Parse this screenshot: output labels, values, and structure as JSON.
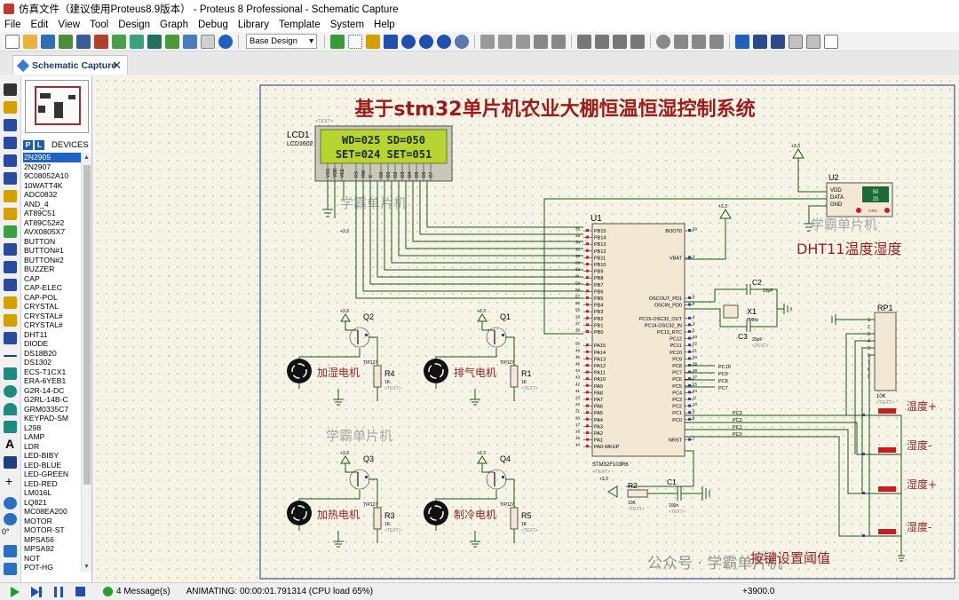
{
  "window": {
    "title": "仿真文件（建议使用Proteus8.9版本） - Proteus 8 Professional - Schematic Capture"
  },
  "menu": [
    "File",
    "Edit",
    "View",
    "Tool",
    "Design",
    "Graph",
    "Debug",
    "Library",
    "Template",
    "System",
    "Help"
  ],
  "toolbar": {
    "design_select": "Base Design"
  },
  "tab": {
    "label": "Schematic Capture"
  },
  "device_panel": {
    "header": "DEVICES",
    "items": [
      "2N2905",
      "2N2907",
      "9C08052A10",
      "10WATT4K",
      "ADC0832",
      "AND_4",
      "AT89C51",
      "AT89C52#2",
      "AVX0805X7",
      "BUTTON",
      "BUTTON#1",
      "BUTTON#2",
      "BUZZER",
      "CAP",
      "CAP-ELEC",
      "CAP-POL",
      "CRYSTAL",
      "CRYSTAL#",
      "CRYSTAL#",
      "DHT11",
      "DIODE",
      "DS18B20",
      "DS1302",
      "ECS-T1CX1",
      "ERA-6YEB1",
      "G2R-14-DC",
      "G2RL-14B-C",
      "GRM0335C7",
      "KEYPAD-SM",
      "L298",
      "LAMP",
      "LDR",
      "LED-BIBY",
      "LED-BLUE",
      "LED-GREEN",
      "LED-RED",
      "LM016L",
      "LQ821",
      "MC08EA200",
      "MOTOR",
      "MOTOR-ST",
      "MPSA56",
      "MPSA92",
      "NOT",
      "POT-HG"
    ],
    "selected_index": 0,
    "rotation_label": "0°"
  },
  "schematic": {
    "title": "基于stm32单片机农业大棚恒温恒湿控制系统",
    "lcd": {
      "ref": "LCD1",
      "part": "LCD1602",
      "line1": "WD=025  SD=050",
      "line2": "SET=024 SET=051",
      "text_tag": "<TEXT>",
      "pins": [
        "VSS",
        "VDD",
        "VEE",
        "RS",
        "RW",
        "E",
        "D0",
        "D1",
        "D2",
        "D3",
        "D4",
        "D5",
        "D6",
        "D7"
      ]
    },
    "watermark": "学霸单片机",
    "dht": {
      "ref": "U2",
      "label": "DHT11温度湿度",
      "pins": [
        "VDD",
        "DATA",
        "GND"
      ],
      "temp": "50",
      "hum": "25",
      "unit": "%RH",
      "power": "+3.3"
    },
    "mcu": {
      "ref": "U1",
      "part": "STM32F103R6",
      "text_tag": "<TEXT>",
      "left_pins": [
        "PB15",
        "PB14",
        "PB13",
        "PB12",
        "PB11",
        "PB10",
        "PB9",
        "PB8",
        "PB7",
        "PB6",
        "PB5",
        "PB4",
        "PB3",
        "PB2",
        "PB1",
        "PB0",
        "",
        "PA15",
        "PA14",
        "PA13",
        "PA12",
        "PA11",
        "PA10",
        "PA9",
        "PA8",
        "PA7",
        "PA6",
        "PA5",
        "PA4",
        "PA3",
        "PA2",
        "PA1",
        "PA0-WKUP"
      ],
      "left_nums": [
        "36",
        "35",
        "34",
        "33",
        "30",
        "29",
        "62",
        "61",
        "59",
        "58",
        "57",
        "56",
        "55",
        "28",
        "27",
        "26",
        "",
        "50",
        "49",
        "46",
        "45",
        "44",
        "43",
        "42",
        "41",
        "23",
        "22",
        "21",
        "20",
        "17",
        "16",
        "15",
        "14"
      ],
      "right_pins": [
        "BOOT0",
        "",
        "",
        "",
        "VBAT",
        "",
        "",
        "",
        "",
        "",
        "OSCOUT_PD1",
        "OSCIN_PD0",
        "",
        "PC15-OSC32_OUT",
        "PC14-OSC32_IN",
        "PC13_RTC",
        "PC12",
        "PC11",
        "PC10",
        "PC9",
        "PC8",
        "PC7",
        "PC6",
        "PC5",
        "PC4",
        "PC3",
        "PC2",
        "PC1",
        "PC0",
        "",
        "",
        "NRST"
      ],
      "right_nums": [
        "60",
        "",
        "",
        "",
        "1",
        "",
        "",
        "",
        "",
        "",
        "6",
        "5",
        "",
        "4",
        "3",
        "2",
        "53",
        "52",
        "51",
        "40",
        "39",
        "38",
        "37",
        "25",
        "24",
        "11",
        "10",
        "9",
        "8",
        "",
        "",
        "7"
      ],
      "power_label": "+3.3"
    },
    "transistors": [
      {
        "ref": "Q2",
        "part": "TIP127",
        "motor_label": "加湿电机",
        "res_ref": "R4",
        "res_val": "1K",
        "net": "PC10",
        "power": "+3.3",
        "text_tag": "<TEXT>"
      },
      {
        "ref": "Q1",
        "part": "TIP127",
        "motor_label": "排气电机",
        "res_ref": "R1",
        "res_val": "1K",
        "net": "PC9",
        "power": "+3.3",
        "text_tag": "<TEXT>"
      },
      {
        "ref": "Q3",
        "part": "TIP127",
        "motor_label": "加热电机",
        "res_ref": "R3",
        "res_val": "1K",
        "net": "PC8",
        "power": "+3.3",
        "text_tag": "<TEXT>"
      },
      {
        "ref": "Q4",
        "part": "TIP127",
        "motor_label": "制冷电机",
        "res_ref": "R5",
        "res_val": "1K",
        "net": "PC7",
        "power": "+3.3",
        "text_tag": "<TEXT>"
      }
    ],
    "crystal": {
      "ref": "X1",
      "freq": "8MHz",
      "c2": "C2",
      "c2_val": "20pF",
      "c3": "C3",
      "c3_val": "20pF",
      "text_tag": "<TEXT>"
    },
    "reset": {
      "r_ref": "R2",
      "r_val": "10K",
      "c_ref": "C1",
      "c_val": "100n",
      "power": "+3.3",
      "text_tag": "<TEXT>"
    },
    "rp": {
      "ref": "RP1",
      "val": "10K",
      "power": "+3.3",
      "text_tag": "<TEXT>",
      "pin_nums": [
        "1",
        "2",
        "3",
        "4",
        "5",
        "6",
        "7",
        "8",
        "9"
      ]
    },
    "buttons": [
      "温度+",
      "湿度-",
      "湿度+",
      "湿度-"
    ],
    "button_nets": [
      "PC3",
      "PC2",
      "PC1",
      "PC0"
    ],
    "lcd_power": "+3.3",
    "bottom_note": "按键设置阈值",
    "bottom_watermark": "公众号 · 学霸单片机"
  },
  "status": {
    "messages": "4 Message(s)",
    "animating": "ANIMATING: 00:00:01.791314 (CPU load 65%)",
    "coord": "+3900.0"
  },
  "colors": {
    "schematic_red": "#9c1c1c",
    "wire_green": "#1a5a1a",
    "lcd_bg": "#b8d432",
    "selection_blue": "#1e62c8"
  }
}
